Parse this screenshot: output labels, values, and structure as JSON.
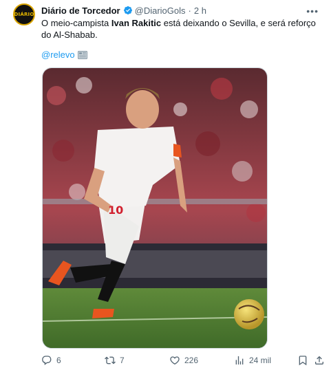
{
  "tweet": {
    "author_name": "Diário de Torcedor",
    "author_handle": "@DiarioGols",
    "separator": "·",
    "time": "2 h",
    "avatar_text": "DIÁRIO",
    "text_before": "O meio-campista ",
    "text_bold": "Ivan Rakitic",
    "text_after": " está deixando o Sevilla, e será reforço do Al-Shabab.",
    "mention": "@relevo",
    "image": {
      "jersey_number": "10"
    }
  },
  "actions": {
    "replies": "6",
    "retweets": "7",
    "likes": "226",
    "views": "24 mil"
  },
  "icons": {
    "verified": "verified-badge-icon",
    "more": "more-options-icon",
    "reply": "reply-icon",
    "retweet": "retweet-icon",
    "like": "heart-icon",
    "views": "views-chart-icon",
    "bookmark": "bookmark-icon",
    "share": "share-icon",
    "news": "newspaper-icon"
  },
  "colors": {
    "accent": "#1d9bf0",
    "text": "#0f1419",
    "secondary": "#536471"
  }
}
